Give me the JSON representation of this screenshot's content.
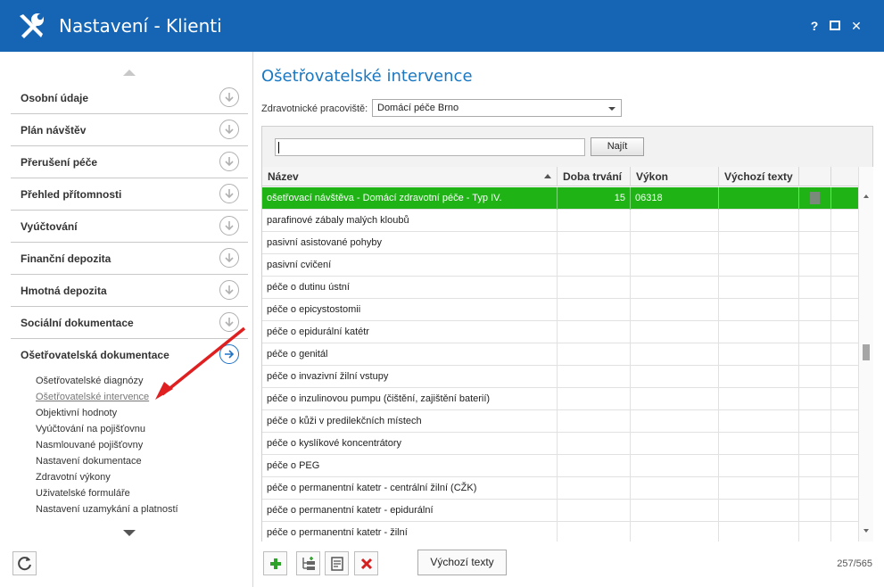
{
  "window": {
    "title": "Nastavení - Klienti",
    "controls": {
      "help": "?",
      "maximize": "□",
      "close": "✕"
    }
  },
  "sidebar": {
    "sections": [
      {
        "label": "Osobní údaje",
        "icon": "arrow-down-circle-icon"
      },
      {
        "label": "Plán návštěv",
        "icon": "arrow-down-circle-icon"
      },
      {
        "label": "Přerušení péče",
        "icon": "arrow-down-circle-icon"
      },
      {
        "label": "Přehled přítomnosti",
        "icon": "arrow-down-circle-icon"
      },
      {
        "label": "Vyúčtování",
        "icon": "arrow-down-circle-icon"
      },
      {
        "label": "Finanční depozita",
        "icon": "arrow-down-circle-icon"
      },
      {
        "label": "Hmotná depozita",
        "icon": "arrow-down-circle-icon"
      },
      {
        "label": "Sociální dokumentace",
        "icon": "arrow-down-circle-icon"
      },
      {
        "label": "Ošetřovatelská dokumentace",
        "icon": "arrow-right-circle-icon",
        "active": true
      }
    ],
    "sub_items": [
      "Ošetřovatelské diagnózy",
      "Ošetřovatelské intervence",
      "Objektivní hodnoty",
      "Vyúčtování na pojišťovnu",
      "Nasmlouvané pojišťovny",
      "Nastavení dokumentace",
      "Zdravotní výkony",
      "Uživatelské formuláře",
      "Nastavení uzamykání a platností"
    ],
    "active_sub_item": "Ošetřovatelské intervence"
  },
  "main": {
    "title": "Ošetřovatelské intervence",
    "filter": {
      "label": "Zdravotnické pracoviště:",
      "value": "Domácí péče Brno"
    },
    "search": {
      "value": "",
      "button_label": "Najít"
    },
    "columns": [
      "Název",
      "Doba trvání",
      "Výkon",
      "Výchozí texty"
    ],
    "rows": [
      {
        "name": "ošetřovací návštěva - Domácí zdravotní péče - Typ IV.",
        "duration": "15",
        "code": "06318",
        "has_doc": true
      },
      {
        "name": "parafinové zábaly malých kloubů",
        "duration": "",
        "code": "",
        "has_doc": false
      },
      {
        "name": "pasivní asistované pohyby",
        "duration": "",
        "code": "",
        "has_doc": false
      },
      {
        "name": "pasivní cvičení",
        "duration": "",
        "code": "",
        "has_doc": false
      },
      {
        "name": "péče o dutinu ústní",
        "duration": "",
        "code": "",
        "has_doc": false
      },
      {
        "name": "péče o epicystostomii",
        "duration": "",
        "code": "",
        "has_doc": false
      },
      {
        "name": "péče o epidurální katétr",
        "duration": "",
        "code": "",
        "has_doc": false
      },
      {
        "name": "péče o genitál",
        "duration": "",
        "code": "",
        "has_doc": false
      },
      {
        "name": "péče o invazivní žilní vstupy",
        "duration": "",
        "code": "",
        "has_doc": false
      },
      {
        "name": "péče o inzulinovou pumpu (čištění, zajištění baterií)",
        "duration": "",
        "code": "",
        "has_doc": false
      },
      {
        "name": "péče o kůži v predilekčních místech",
        "duration": "",
        "code": "",
        "has_doc": false
      },
      {
        "name": "péče o kyslíkové koncentrátory",
        "duration": "",
        "code": "",
        "has_doc": false
      },
      {
        "name": "péče o PEG",
        "duration": "",
        "code": "",
        "has_doc": false
      },
      {
        "name": "péče o permanentní katetr - centrální žilní (CŽK)",
        "duration": "",
        "code": "",
        "has_doc": false
      },
      {
        "name": "péče o permanentní katetr - epidurální",
        "duration": "",
        "code": "",
        "has_doc": false
      },
      {
        "name": "péče o permanentní katetr - žilní",
        "duration": "",
        "code": "",
        "has_doc": false
      }
    ],
    "toolbar": {
      "add_icon": "plus-icon",
      "add_child_icon": "add-tree-icon",
      "edit_icon": "edit-doc-icon",
      "delete_icon": "delete-x-icon",
      "defaults_label": "Výchozí texty"
    },
    "counter": "257/565"
  },
  "colors": {
    "titlebar": "#1565b4",
    "accent": "#1a78c2",
    "selected_row": "#1fb316",
    "add": "#2ea12a",
    "delete": "#d32020",
    "annotation": "#e02020"
  }
}
